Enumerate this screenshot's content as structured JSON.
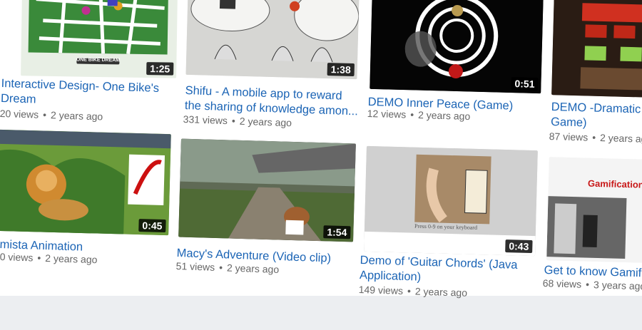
{
  "videos": [
    {
      "title1": "Interactive Design- One Bike's",
      "title2": "Dream",
      "duration": "1:25",
      "views": "20 views",
      "age": "2 years ago",
      "logo": "ONE BIKE DREAM"
    },
    {
      "title1": "Shifu - A mobile app to reward",
      "title2": "the sharing of knowledge amon...",
      "duration": "1:38",
      "views": "331 views",
      "age": "2 years ago"
    },
    {
      "title1": "DEMO Inner Peace (Game)",
      "title2": "",
      "duration": "0:51",
      "views": "12 views",
      "age": "2 years ago"
    },
    {
      "title1": "DEMO -Dramatic (",
      "title2": "Game)",
      "duration": "",
      "views": "87 views",
      "age": "2 years ag"
    },
    {
      "title1": "mista Animation",
      "title2": "",
      "duration": "0:45",
      "views": "0 views",
      "age": "2 years ago"
    },
    {
      "title1": "Macy's Adventure (Video clip)",
      "title2": "",
      "duration": "1:54",
      "views": "51 views",
      "age": "2 years ago"
    },
    {
      "title1": "Demo of 'Guitar Chords' (Java",
      "title2": "Application)",
      "duration": "0:43",
      "views": "149 views",
      "age": "2 years ago",
      "caption": "Press 0-9 on your keyboard"
    },
    {
      "title1": "Get to know Gamifi",
      "title2": "",
      "duration": "",
      "views": "68 views",
      "age": "3 years ago",
      "slide_title": "Gamification"
    }
  ],
  "separator": "•"
}
